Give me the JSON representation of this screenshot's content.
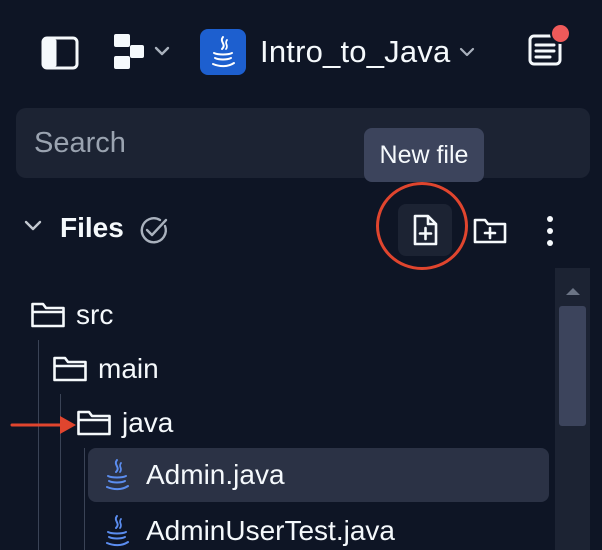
{
  "project": {
    "name": "Intro_to_Java",
    "icon": "java-icon"
  },
  "search": {
    "placeholder": "Search",
    "value": ""
  },
  "tooltip": {
    "text": "New file"
  },
  "files_panel": {
    "title": "Files"
  },
  "tree": [
    {
      "label": "src",
      "type": "folder",
      "depth": 0
    },
    {
      "label": "main",
      "type": "folder",
      "depth": 1
    },
    {
      "label": "java",
      "type": "folder",
      "depth": 2
    },
    {
      "label": "Admin.java",
      "type": "java-file",
      "depth": 3,
      "selected": true
    },
    {
      "label": "AdminUserTest.java",
      "type": "java-file",
      "depth": 3
    }
  ],
  "colors": {
    "background": "#0e1525",
    "panel": "#1c2333",
    "highlight": "#e0452e",
    "notification": "#ef5a5a",
    "java_blue": "#1d5fcf"
  }
}
